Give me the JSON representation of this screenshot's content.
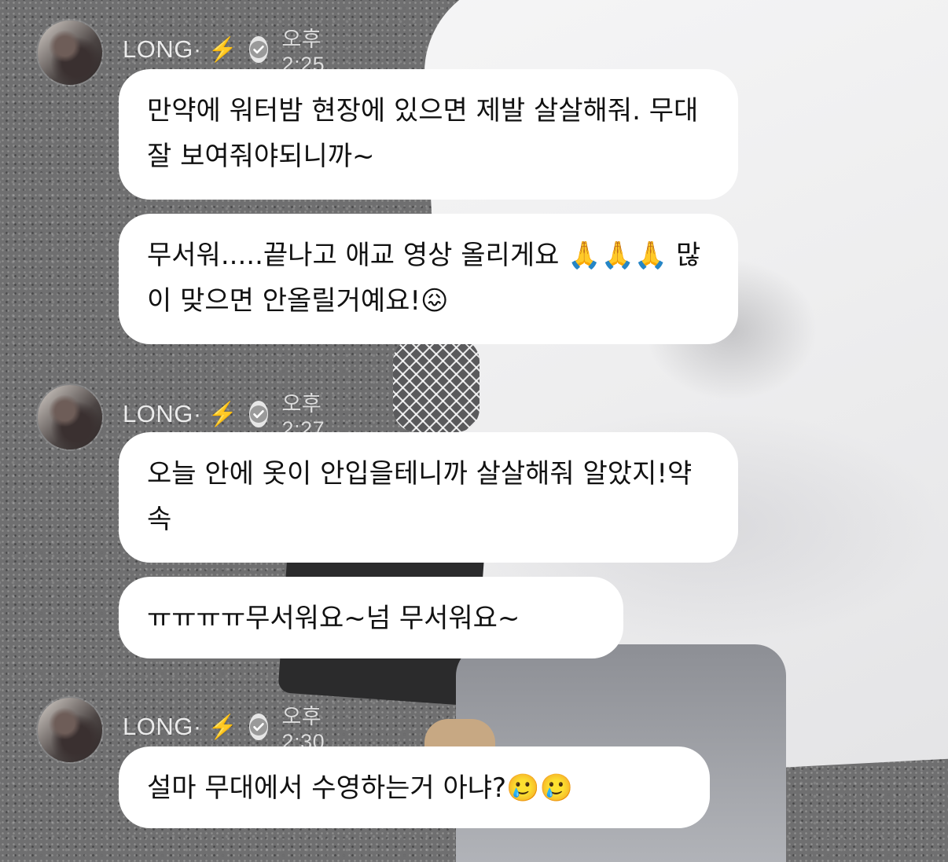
{
  "messages": [
    {
      "author": "LONG·",
      "author_emoji": "⚡",
      "time": "오후 2:25",
      "bubbles": [
        "만약에 워터밤 현장에 있으면 제발 살살해줘. 무대 잘 보여줘야되니까~",
        "무서워.....끝나고 애교 영상 올리게요 🙏🙏🙏 많이 맞으면 안올릴거예요!😖"
      ]
    },
    {
      "author": "LONG·",
      "author_emoji": "⚡",
      "time": "오후 2:27",
      "bubbles": [
        "오늘 안에 옷이 안입을테니까 살살해줘 알았지!약속",
        "ㅠㅠㅠㅠ무서워요~넘 무서워요~"
      ]
    },
    {
      "author": "LONG·",
      "author_emoji": "⚡",
      "time": "오후 2:30",
      "bubbles": [
        "설마 무대에서 수영하는거 아냐?🥲🥲"
      ]
    }
  ],
  "icons": {
    "avatar": "avatar",
    "verified": "verified-check-icon",
    "bolt": "lightning-bolt-icon"
  },
  "colors": {
    "bubble": "#ffffff",
    "bubble_text": "#111111",
    "header_text": "#ffffff",
    "bolt": "#f5c518"
  }
}
